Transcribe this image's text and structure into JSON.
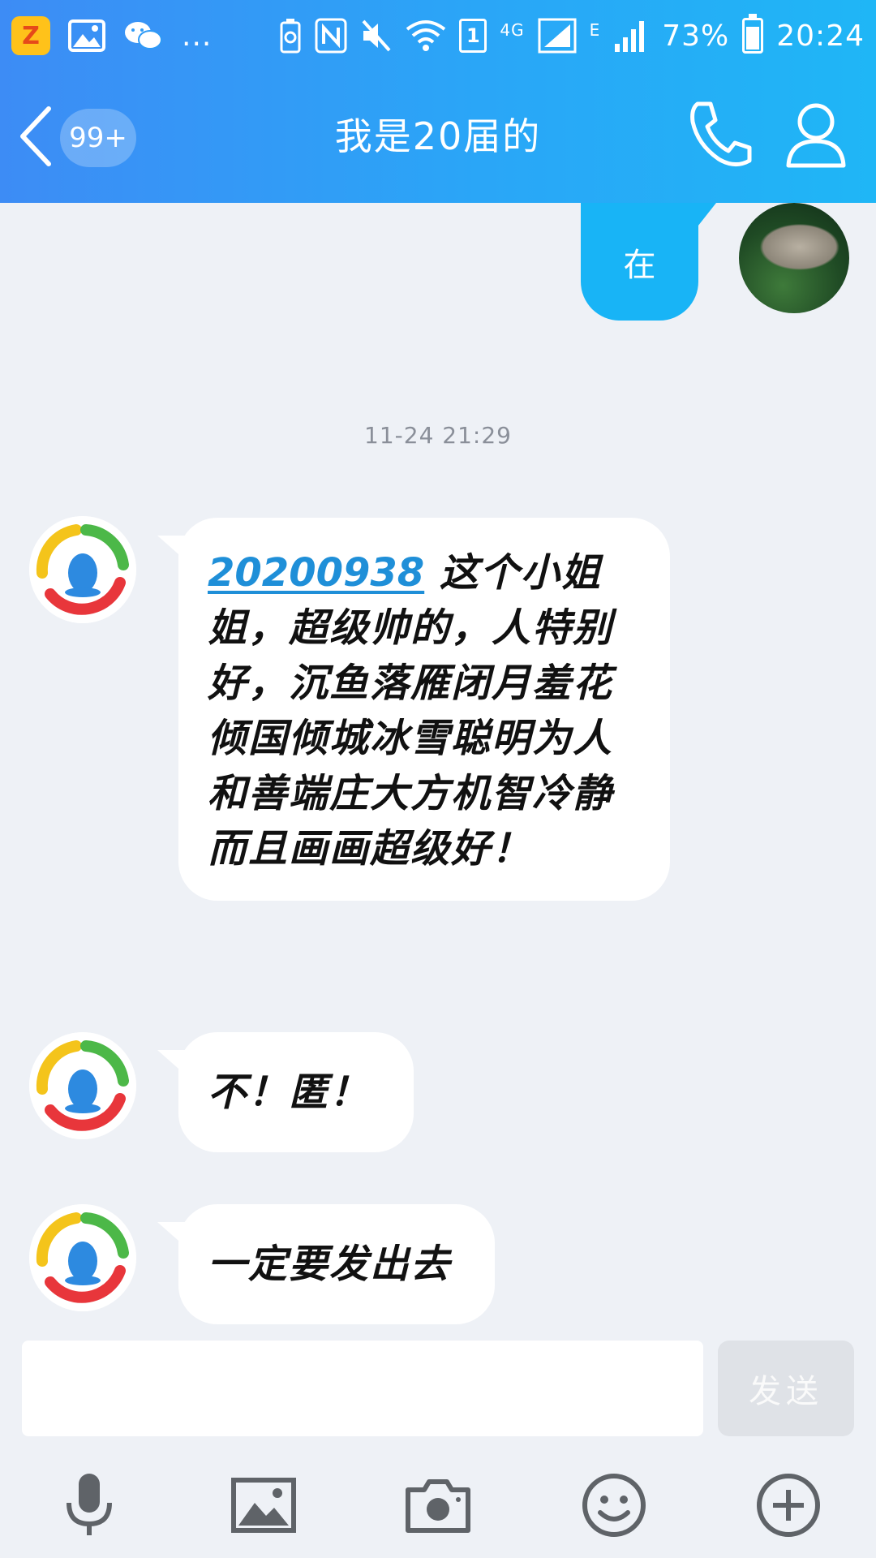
{
  "status_bar": {
    "qzone_badge": "Z",
    "more_dots": "...",
    "network_4g": "4G",
    "network_e": "E",
    "sim_slot": "1",
    "battery_percent": "73%",
    "time": "20:24"
  },
  "header": {
    "unread_count": "99+",
    "title": "我是20届的"
  },
  "messages": {
    "outgoing_1": "在",
    "timestamp": "11-24 21:29",
    "incoming_1": {
      "mention": "20200938",
      "text": " 这个小姐姐，超级帅的，人特别好，沉鱼落雁闭月羞花倾国倾城冰雪聪明为人和善端庄大方机智冷静而且画画超级好！"
    },
    "incoming_2": "不！匿！",
    "incoming_3": "一定要发出去"
  },
  "composer": {
    "input_value": "",
    "send_label": "发送"
  },
  "colors": {
    "header_start": "#3d8cf5",
    "header_end": "#1fb6f6",
    "outgoing_bubble": "#18b4f6",
    "background": "#eef1f6",
    "mention": "#1f8fd8"
  }
}
